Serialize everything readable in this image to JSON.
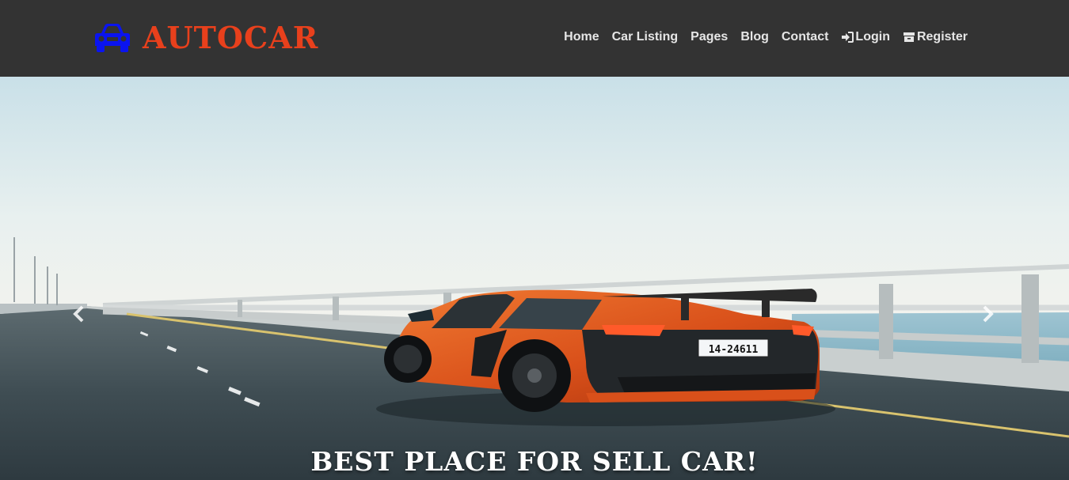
{
  "brand": {
    "name": "AUTOCAR",
    "icon": "car-icon",
    "icon_color": "#0a14f0",
    "text_color": "#e8401c"
  },
  "nav": {
    "items": [
      {
        "label": "Home"
      },
      {
        "label": "Car Listing"
      },
      {
        "label": "Pages"
      },
      {
        "label": "Blog"
      },
      {
        "label": "Contact"
      },
      {
        "label": "Login",
        "icon": "sign-in-icon"
      },
      {
        "label": "Register",
        "icon": "archive-icon"
      }
    ]
  },
  "hero": {
    "caption": "BEST PLACE FOR SELL CAR!",
    "image": "orange-supercar-on-bridge",
    "license_plate": "14-24611",
    "controls": {
      "prev": "chevron-left-icon",
      "next": "chevron-right-icon"
    }
  },
  "colors": {
    "navbar_bg": "#333333",
    "nav_text": "#e6e6e6",
    "car_body": "#e05a1e"
  }
}
